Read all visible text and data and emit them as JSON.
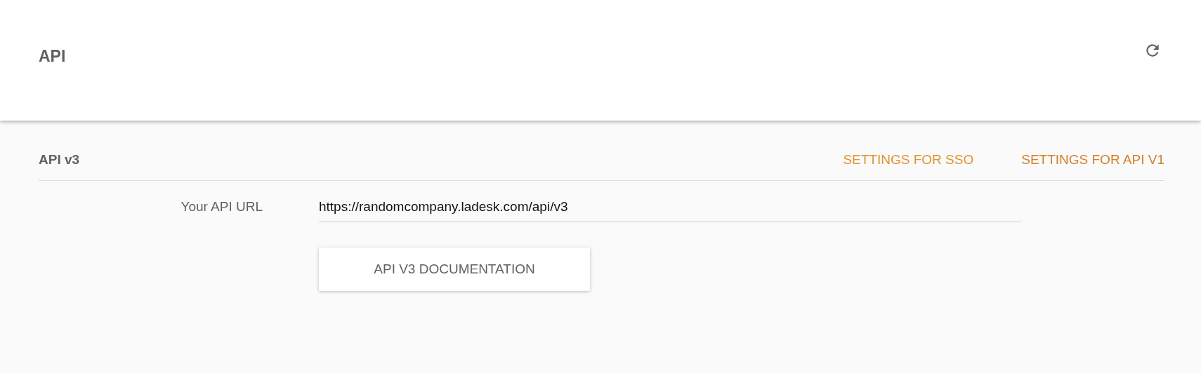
{
  "header": {
    "title": "API"
  },
  "section": {
    "title": "API v3",
    "links": [
      {
        "label": "SETTINGS FOR SSO",
        "color": "#e3922f"
      },
      {
        "label": "SETTINGS FOR API V1",
        "color": "#d3812b"
      }
    ]
  },
  "field": {
    "label": "Your API URL",
    "value": "https://randomcompany.ladesk.com/api/v3"
  },
  "button": {
    "label": "API V3 DOCUMENTATION"
  }
}
